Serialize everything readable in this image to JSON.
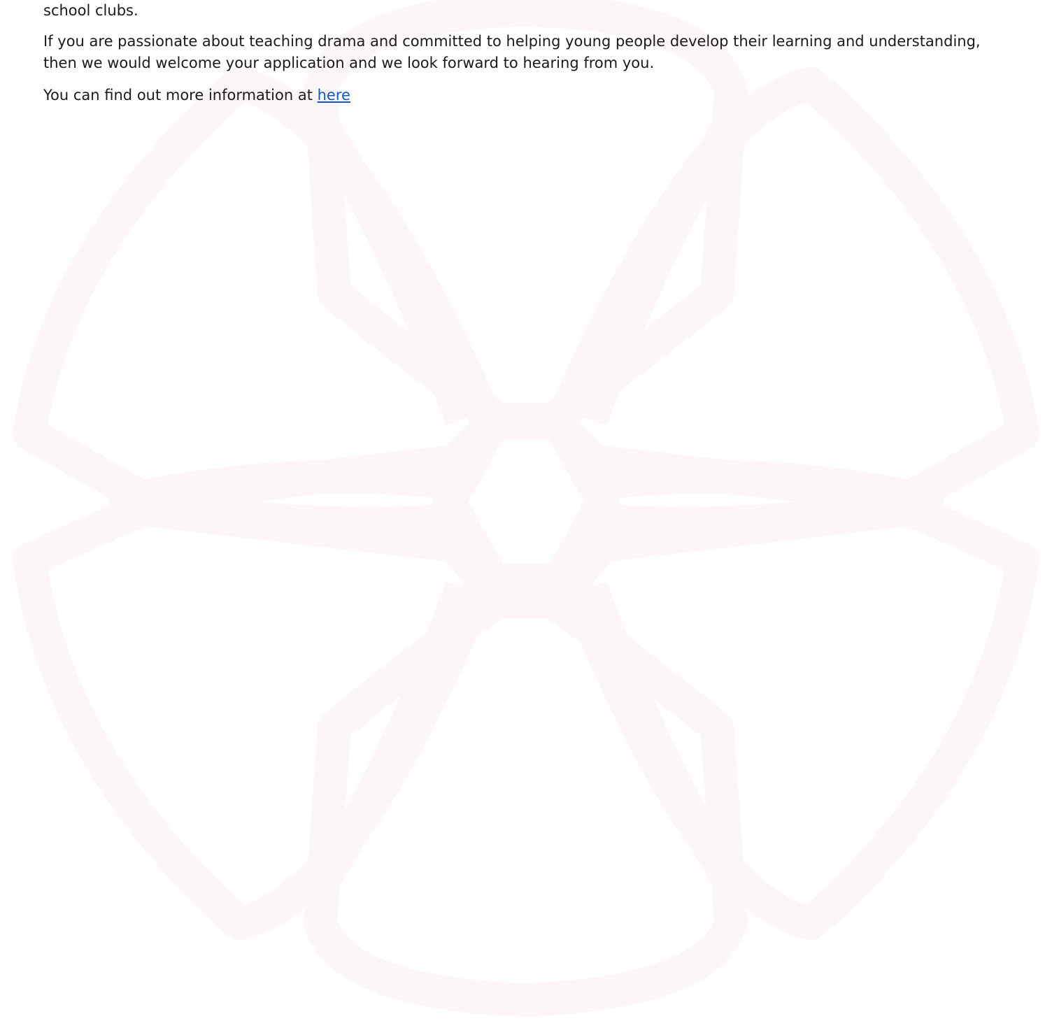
{
  "document": {
    "paragraphs": {
      "fragment": "school clubs.",
      "passion": "If you are passionate about teaching drama and committed to helping young people develop their learning and understanding, then we would welcome your application and we look forward to hearing from you.",
      "more_info_prefix": "You can find out more information at ",
      "more_info_link": "here"
    }
  },
  "colors": {
    "text": "#1a1a1a",
    "link": "#1155cc",
    "watermark": "#fdf8f8"
  },
  "watermark": {
    "icon": "flower-logo-icon"
  }
}
